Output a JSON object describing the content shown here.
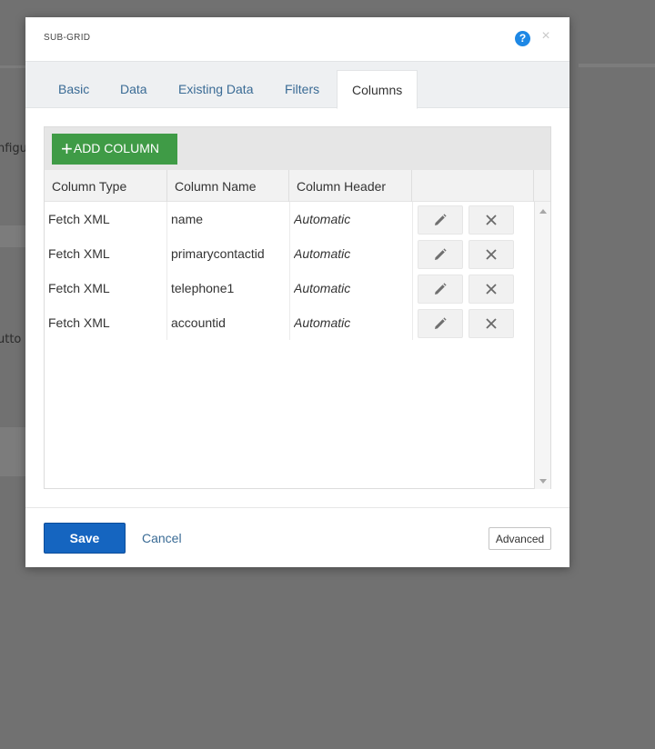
{
  "background": {
    "fragments": [
      "nfigu",
      "utto"
    ]
  },
  "modal": {
    "title": "SUB-GRID",
    "help_glyph": "?",
    "close_glyph": "×"
  },
  "tabs": [
    {
      "label": "Basic",
      "active": false
    },
    {
      "label": "Data",
      "active": false
    },
    {
      "label": "Existing Data",
      "active": false
    },
    {
      "label": "Filters",
      "active": false
    },
    {
      "label": "Columns",
      "active": true
    }
  ],
  "toolbar": {
    "add_icon": "+",
    "add_label": "ADD COLUMN"
  },
  "grid": {
    "headers": [
      "Column Type",
      "Column Name",
      "Column Header"
    ],
    "rows": [
      {
        "type": "Fetch XML",
        "name": "name",
        "header": "Automatic"
      },
      {
        "type": "Fetch XML",
        "name": "primarycontactid",
        "header": "Automatic"
      },
      {
        "type": "Fetch XML",
        "name": "telephone1",
        "header": "Automatic"
      },
      {
        "type": "Fetch XML",
        "name": "accountid",
        "header": "Automatic"
      }
    ],
    "row_actions": [
      "pencil-icon",
      "close-x-icon"
    ]
  },
  "footer": {
    "save_label": "Save",
    "cancel_label": "Cancel",
    "advanced_label": "Advanced"
  },
  "colors": {
    "overlay": "#717171",
    "add_button": "#3f9b46",
    "save_button": "#1565c0",
    "help_icon": "#1e88e5",
    "link": "#3a6b95"
  }
}
